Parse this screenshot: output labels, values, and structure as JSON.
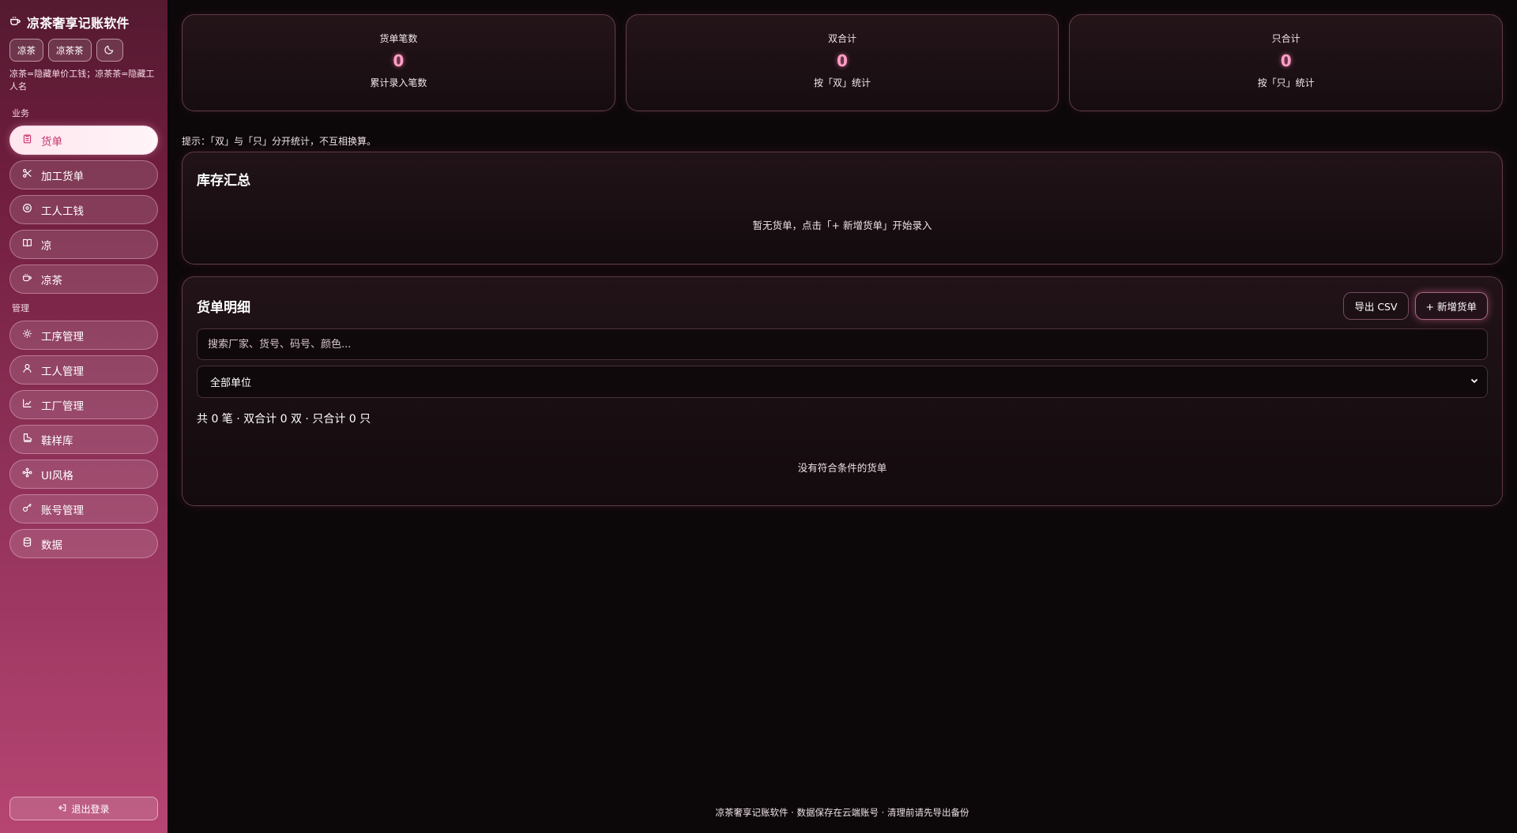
{
  "brand": {
    "title": "凉茶奢享记账软件",
    "icon": "coffee-cup-icon"
  },
  "modes": {
    "option1": "凉茶",
    "option2": "凉茶茶",
    "theme_icon": "moon-icon"
  },
  "hint": "凉茶=隐藏单价工钱；凉茶茶=隐藏工人名",
  "sections": {
    "business": "业务",
    "management": "管理"
  },
  "nav_business": [
    {
      "label": "货单",
      "icon": "clipboard-icon",
      "active": true
    },
    {
      "label": "加工货单",
      "icon": "scissors-icon"
    },
    {
      "label": "工人工钱",
      "icon": "coin-icon"
    },
    {
      "label": "凉",
      "icon": "book-icon"
    },
    {
      "label": "凉茶",
      "icon": "coffee-cup-icon"
    }
  ],
  "nav_management": [
    {
      "label": "工序管理",
      "icon": "sun-gear-icon"
    },
    {
      "label": "工人管理",
      "icon": "user-icon"
    },
    {
      "label": "工厂管理",
      "icon": "factory-icon"
    },
    {
      "label": "鞋样库",
      "icon": "shoe-icon"
    },
    {
      "label": "UI风格",
      "icon": "palette-icon"
    },
    {
      "label": "账号管理",
      "icon": "key-icon"
    },
    {
      "label": "数据",
      "icon": "database-icon"
    }
  ],
  "logout": {
    "label": "退出登录",
    "icon": "logout-icon"
  },
  "stats": [
    {
      "label": "货单笔数",
      "value": "0",
      "sub": "累计录入笔数"
    },
    {
      "label": "双合计",
      "value": "0",
      "sub": "按「双」统计"
    },
    {
      "label": "只合计",
      "value": "0",
      "sub": "按「只」统计"
    }
  ],
  "tip": "提示：「双」与「只」分开统计，不互相换算。",
  "inventory": {
    "title": "库存汇总",
    "empty_text": "暂无货单，点击「+ 新增货单」开始录入"
  },
  "detail": {
    "title": "货单明细",
    "export_label": "导出 CSV",
    "add_label": "+ 新增货单",
    "search_placeholder": "搜索厂家、货号、码号、颜色...",
    "unit_select_value": "全部单位",
    "summary": "共 0 笔 · 双合计 0 双 · 只合计 0 只",
    "empty_text": "没有符合条件的货单"
  },
  "footer": "凉茶奢享记账软件 · 数据保存在云端账号 · 清理前请先导出备份",
  "colors": {
    "accent": "#ff9ec6",
    "sidebar_top": "#541a30",
    "sidebar_bottom": "#b64572",
    "background": "#0c0809"
  }
}
